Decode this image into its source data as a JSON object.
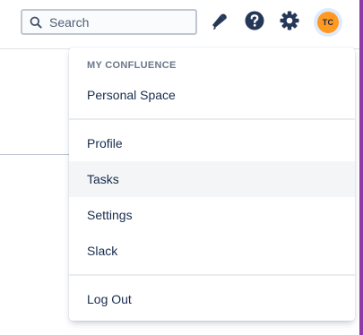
{
  "header": {
    "search": {
      "placeholder": "Search",
      "value": "",
      "icon": "search-icon"
    },
    "icons": [
      "notification-icon",
      "help-icon",
      "gear-icon"
    ],
    "avatar": {
      "initials": "TC",
      "bg_color": "#ff991f",
      "ring_color": "#deebff"
    }
  },
  "menu": {
    "heading": "MY CONFLUENCE",
    "groups": [
      {
        "items": [
          "Personal Space"
        ]
      },
      {
        "items": [
          "Profile",
          "Tasks",
          "Settings",
          "Slack"
        ]
      },
      {
        "items": [
          "Log Out"
        ]
      }
    ],
    "highlighted_item": "Tasks"
  },
  "colors": {
    "text_primary": "#172b4d",
    "heading_text": "#6b778c",
    "icon_color": "#253858",
    "hover_bg": "#f4f5f7",
    "accent_right": "#8e3aa5"
  }
}
